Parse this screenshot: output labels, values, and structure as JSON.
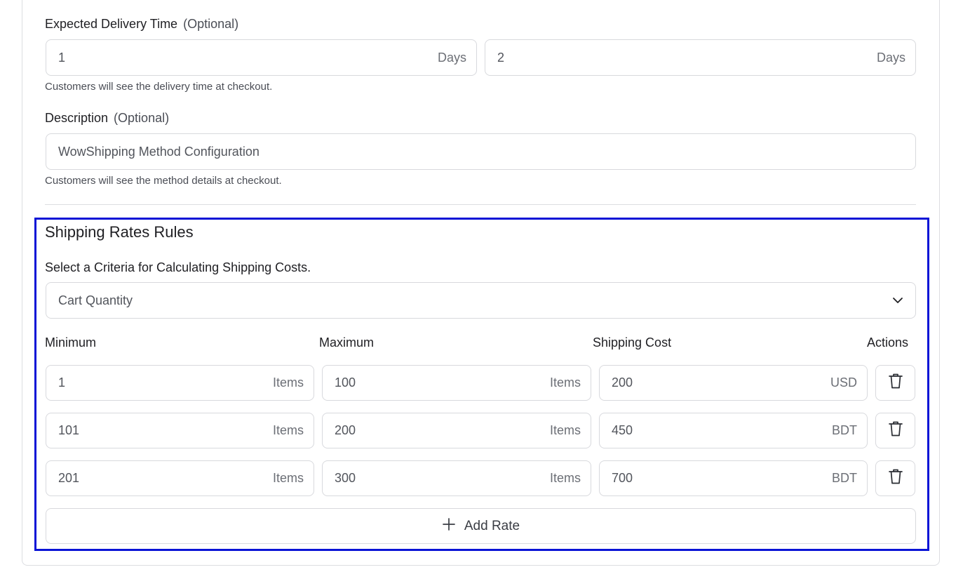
{
  "delivery": {
    "label": "Expected Delivery Time",
    "optional": "(Optional)",
    "min_value": "1",
    "min_suffix": "Days",
    "max_value": "2",
    "max_suffix": "Days",
    "help": "Customers will see the delivery time at checkout."
  },
  "description": {
    "label": "Description",
    "optional": "(Optional)",
    "value": "WowShipping Method Configuration",
    "help": "Customers will see the method details at checkout."
  },
  "rules": {
    "title": "Shipping Rates Rules",
    "criteria_label": "Select a Criteria for Calculating Shipping Costs.",
    "criteria_value": "Cart Quantity",
    "columns": {
      "minimum": "Minimum",
      "maximum": "Maximum",
      "cost": "Shipping Cost",
      "actions": "Actions"
    },
    "rows": [
      {
        "min": "1",
        "min_unit": "Items",
        "max": "100",
        "max_unit": "Items",
        "cost": "200",
        "currency": "USD"
      },
      {
        "min": "101",
        "min_unit": "Items",
        "max": "200",
        "max_unit": "Items",
        "cost": "450",
        "currency": "BDT"
      },
      {
        "min": "201",
        "min_unit": "Items",
        "max": "300",
        "max_unit": "Items",
        "cost": "700",
        "currency": "BDT"
      }
    ],
    "add_rate_label": "Add Rate"
  },
  "icons": {
    "dropdown": "chevron-down-icon",
    "delete": "trash-icon",
    "add": "plus-icon"
  },
  "colors": {
    "highlight_border": "#0a14d6"
  }
}
